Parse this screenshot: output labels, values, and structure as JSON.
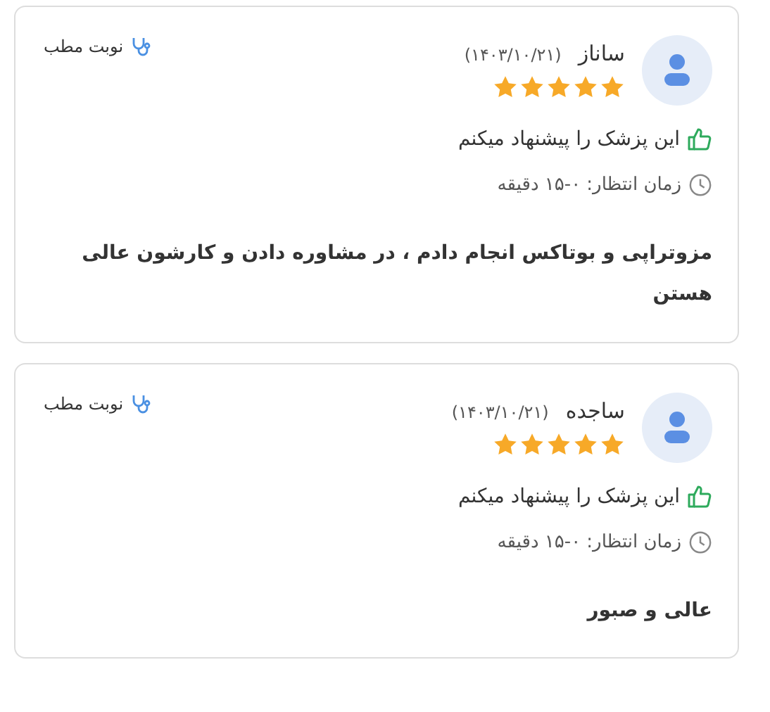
{
  "reviews": [
    {
      "name": "ساناز",
      "date": "(۱۴۰۳/۱۰/۲۱)",
      "stars": 5,
      "recommend": "این پزشک را پیشنهاد میکنم",
      "wait": "زمان انتظار: ۰-۱۵ دقیقه",
      "visit": "نوبت مطب",
      "comment": "مزوتراپی و بوتاکس انجام دادم ، در مشاوره دادن و کارشون عالی هستن"
    },
    {
      "name": "ساجده",
      "date": "(۱۴۰۳/۱۰/۲۱)",
      "stars": 5,
      "recommend": "این پزشک را پیشنهاد میکنم",
      "wait": "زمان انتظار: ۰-۱۵ دقیقه",
      "visit": "نوبت مطب",
      "comment": "عالی و صبور"
    }
  ]
}
